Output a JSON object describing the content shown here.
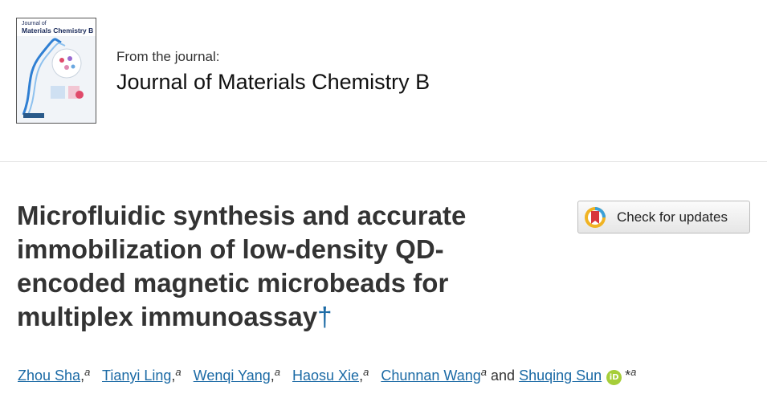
{
  "journal": {
    "cover": {
      "title_line1": "Journal of",
      "title_line2": "Materials Chemistry B"
    },
    "from_label": "From the journal:",
    "name": "Journal of Materials Chemistry B"
  },
  "updates_button": {
    "label": "Check for updates",
    "icon": "crossmark-icon"
  },
  "article": {
    "title": "Microfluidic synthesis and accurate immobilization of low-density QD-encoded magnetic microbeads for multiplex immunoassay",
    "title_marker": "†",
    "authors": [
      {
        "name": "Zhou Sha",
        "aff": "a",
        "sep": ","
      },
      {
        "name": "Tianyi Ling",
        "aff": "a",
        "sep": ","
      },
      {
        "name": "Wenqi Yang",
        "aff": "a",
        "sep": ","
      },
      {
        "name": "Haosu Xie",
        "aff": "a",
        "sep": ","
      },
      {
        "name": "Chunnan Wang",
        "aff": "a",
        "sep": ""
      },
      {
        "name": "Shuqing Sun",
        "aff": "a",
        "corresponding": "*",
        "orcid": "iD"
      }
    ],
    "and_text": "and"
  },
  "colors": {
    "link": "#1b6aa5",
    "orcid": "#a6ce39",
    "title_text": "#333333"
  }
}
